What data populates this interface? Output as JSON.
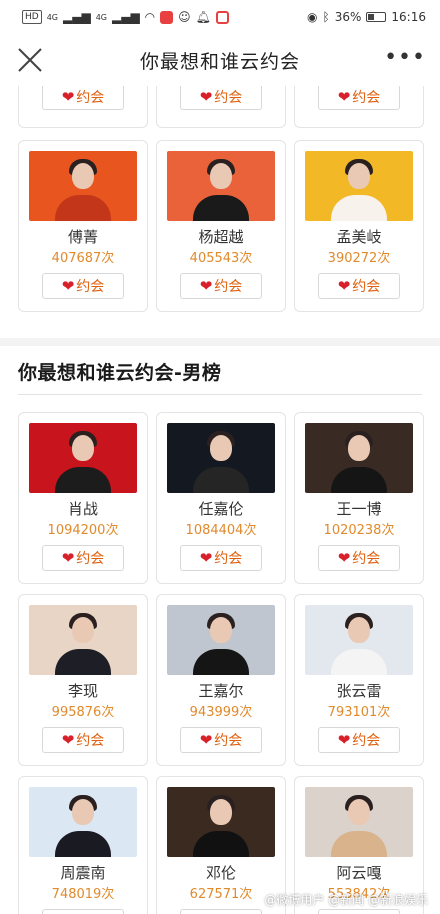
{
  "status_bar": {
    "network_tag": "HD",
    "signal1": "4G",
    "signal2": "4G",
    "battery_percent": "36%",
    "battery_level": 0.36,
    "time": "16:16"
  },
  "header": {
    "title": "你最想和谁云约会",
    "more_label": "•••"
  },
  "date_label": "约会",
  "female_partial_row": [
    {
      "button": "约会"
    },
    {
      "button": "约会"
    },
    {
      "button": "约会"
    }
  ],
  "female_row": [
    {
      "name": "傅菁",
      "count": "407687次",
      "photo_bg": "#e8551f",
      "outfit": "#c4361a"
    },
    {
      "name": "杨超越",
      "count": "405543次",
      "photo_bg": "#e9623a",
      "outfit": "#1a1a1a"
    },
    {
      "name": "孟美岐",
      "count": "390272次",
      "photo_bg": "#f3b825",
      "outfit": "#f7f2ec"
    }
  ],
  "male_section": {
    "title": "你最想和谁云约会-男榜",
    "rows": [
      [
        {
          "name": "肖战",
          "count": "1094200次",
          "photo_bg": "#c8141c",
          "outfit": "#1c1c1c"
        },
        {
          "name": "任嘉伦",
          "count": "1084404次",
          "photo_bg": "#141820",
          "outfit": "#252525"
        },
        {
          "name": "王一博",
          "count": "1020238次",
          "photo_bg": "#3a2a24",
          "outfit": "#151515"
        }
      ],
      [
        {
          "name": "李现",
          "count": "995876次",
          "photo_bg": "#e8d5c6",
          "outfit": "#1e1e26"
        },
        {
          "name": "王嘉尔",
          "count": "943999次",
          "photo_bg": "#bfc6d0",
          "outfit": "#151515"
        },
        {
          "name": "张云雷",
          "count": "793101次",
          "photo_bg": "#e3e7ee",
          "outfit": "#f4f4f4"
        }
      ],
      [
        {
          "name": "周震南",
          "count": "748019次",
          "photo_bg": "#dbe7f3",
          "outfit": "#1a1a22"
        },
        {
          "name": "邓伦",
          "count": "627571次",
          "photo_bg": "#3a2a20",
          "outfit": "#111111"
        },
        {
          "name": "阿云嘎",
          "count": "553842次",
          "photo_bg": "#dcd2cc",
          "outfit": "#d9b38c"
        }
      ]
    ]
  },
  "watermark": "@微博用户 @新闻 @新浪娱乐"
}
